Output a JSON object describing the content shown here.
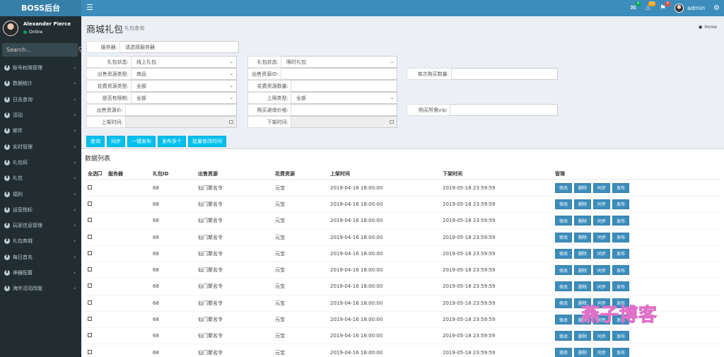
{
  "header": {
    "logo": "BOSS后台",
    "menu_icon": "bars-icon",
    "mail_badge": "4",
    "bell_badge": "10",
    "flag_badge": "9",
    "user": "admin"
  },
  "sidebar": {
    "user_name": "Alexander Pierce",
    "status": "Online",
    "search_placeholder": "Search...",
    "items": [
      {
        "label": "账号权限管理"
      },
      {
        "label": "数据统计"
      },
      {
        "label": "日志查询"
      },
      {
        "label": "活动"
      },
      {
        "label": "邮件"
      },
      {
        "label": "实时管理"
      },
      {
        "label": "礼包码"
      },
      {
        "label": "礼包"
      },
      {
        "label": "福利"
      },
      {
        "label": "运营指标"
      },
      {
        "label": "玩家信息管理"
      },
      {
        "label": "礼包商城"
      },
      {
        "label": "每日首充"
      },
      {
        "label": "神器配置"
      },
      {
        "label": "海外活动改版"
      }
    ]
  },
  "page": {
    "title": "商城礼包",
    "subtitle": "礼包查询",
    "breadcrumb": "Home"
  },
  "form": {
    "server_label": "服务器:",
    "server_value": "请选择服务器",
    "gift_status_label": "礼包状态:",
    "gift_status_value": "线上礼包",
    "limit_status_label": "礼包状态:",
    "limit_status_value": "限时礼包",
    "sell_type_label": "出售资源类型:",
    "sell_type_value": "商品",
    "sell_id_label": "出售资源ID:",
    "sell_id_value": "",
    "single_buy_label": "单次购买数量:",
    "single_buy_value": "",
    "cost_type_label": "花费资源类型:",
    "cost_type_value": "全部",
    "cost_qty_label": "花费资源数量:",
    "cost_qty_value": "",
    "has_limit_label": "是否有限制:",
    "has_limit_value": "全部",
    "limit_type_label": "上限类型:",
    "limit_type_value": "全部",
    "sell_price_label": "出售资源价:",
    "sell_price_value": "",
    "buy_price_label": "购买递增价格:",
    "buy_price_value": "",
    "vip_label": "购买所需vip:",
    "vip_value": "",
    "on_time_label": "上架时间:",
    "on_time_value": "",
    "off_time_label": "下架时间:",
    "off_time_value": ""
  },
  "buttons": {
    "query": "查询",
    "sync": "同步",
    "publish_one": "一键发布",
    "publish_many": "发布多个",
    "batch_time": "批量修改时间"
  },
  "table": {
    "title": "数据列表",
    "headers": [
      "全选",
      "服务器",
      "礼包ID",
      "出售资源",
      "花费资源",
      "上架时间",
      "下架时间",
      "管理"
    ],
    "actions": [
      "修改",
      "删除",
      "同步",
      "发布"
    ],
    "rows": [
      {
        "server": "",
        "id": "68",
        "sell": "仙门聚名令",
        "cost": "元宝",
        "on": "2019-04-16 18:00:00",
        "off": "2019-05-18 23:59:59"
      },
      {
        "server": "",
        "id": "68",
        "sell": "仙门聚名令",
        "cost": "元宝",
        "on": "2019-04-16 18:00:00",
        "off": "2019-05-18 23:59:59"
      },
      {
        "server": "",
        "id": "68",
        "sell": "仙门聚名令",
        "cost": "元宝",
        "on": "2019-04-16 18:00:00",
        "off": "2019-05-18 23:59:59"
      },
      {
        "server": "",
        "id": "68",
        "sell": "仙门聚名令",
        "cost": "元宝",
        "on": "2019-04-16 18:00:00",
        "off": "2019-05-18 23:59:59"
      },
      {
        "server": "",
        "id": "68",
        "sell": "仙门聚名令",
        "cost": "元宝",
        "on": "2019-04-16 18:00:00",
        "off": "2019-05-18 23:59:59"
      },
      {
        "server": "",
        "id": "68",
        "sell": "仙门聚名令",
        "cost": "元宝",
        "on": "2019-04-16 18:00:00",
        "off": "2019-05-18 23:59:59"
      },
      {
        "server": "",
        "id": "68",
        "sell": "仙门聚名令",
        "cost": "元宝",
        "on": "2019-04-16 18:00:00",
        "off": "2019-05-18 23:59:59"
      },
      {
        "server": "",
        "id": "68",
        "sell": "仙门聚名令",
        "cost": "元宝",
        "on": "2019-04-16 18:00:00",
        "off": "2019-05-18 23:59:59"
      },
      {
        "server": "",
        "id": "68",
        "sell": "仙门聚名令",
        "cost": "元宝",
        "on": "2019-04-16 18:00:00",
        "off": "2019-05-18 23:59:59"
      },
      {
        "server": "",
        "id": "68",
        "sell": "仙门聚名令",
        "cost": "元宝",
        "on": "2019-04-16 18:00:00",
        "off": "2019-05-18 23:59:59"
      },
      {
        "server": "",
        "id": "68",
        "sell": "仙门聚名令",
        "cost": "元宝",
        "on": "2019-04-16 18:00:00",
        "off": "2019-05-18 23:59:59"
      }
    ]
  },
  "watermark": "燕子博客"
}
